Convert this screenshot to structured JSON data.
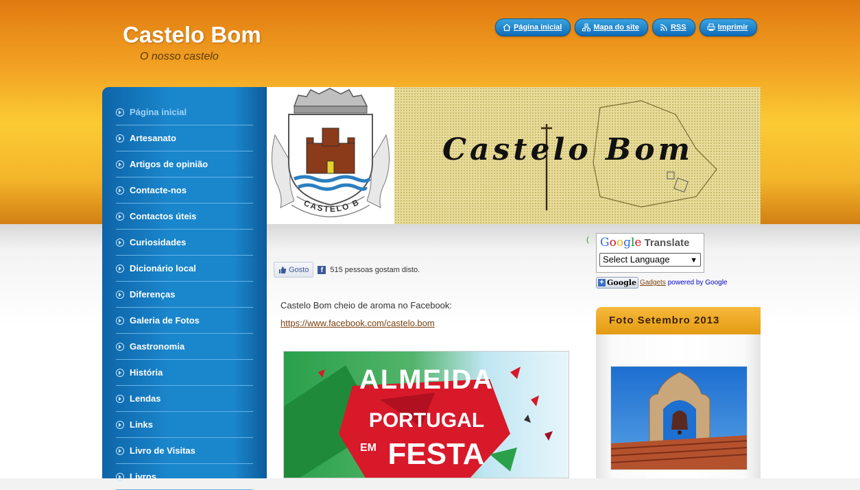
{
  "site": {
    "title": "Castelo Bom",
    "subtitle": "O nosso castelo"
  },
  "top_links": [
    {
      "label": "Página inicial",
      "icon": "home-icon"
    },
    {
      "label": "Mapa do site",
      "icon": "sitemap-icon"
    },
    {
      "label": "RSS",
      "icon": "rss-icon"
    },
    {
      "label": "Imprimir",
      "icon": "print-icon"
    }
  ],
  "nav": {
    "items": [
      {
        "label": "Página inicial",
        "active": true
      },
      {
        "label": "Artesanato"
      },
      {
        "label": "Artigos de opinião"
      },
      {
        "label": "Contacte-nos"
      },
      {
        "label": "Contactos úteis"
      },
      {
        "label": "Curiosidades"
      },
      {
        "label": "Dicionário local"
      },
      {
        "label": "Diferenças"
      },
      {
        "label": "Galeria de Fotos"
      },
      {
        "label": "Gastronomia"
      },
      {
        "label": "História"
      },
      {
        "label": "Lendas"
      },
      {
        "label": "Links"
      },
      {
        "label": "Livro de Visitas"
      },
      {
        "label": "Livros"
      }
    ]
  },
  "banner": {
    "crest_label": "CASTELO BOM",
    "title": "Castelo Bom"
  },
  "facebook": {
    "like_label": "Gosto",
    "icon": "facebook-icon",
    "count_text": "515 pessoas gostam disto."
  },
  "post": {
    "text": "Castelo Bom cheio de aroma no Facebook:",
    "link": "https://www.facebook.com/castelo.bom"
  },
  "poster": {
    "line1": "ALMEIDA",
    "line2": "PORTUGAL",
    "line3": "EM",
    "line4": "FESTA"
  },
  "translate": {
    "brand": "Google",
    "title": "Translate",
    "select_value": "Select Language",
    "stray": "("
  },
  "gadgets": {
    "button_word": "Google",
    "link_text": "Gadgets",
    "powered_text": "powered by Google"
  },
  "photo_box": {
    "title": "Foto Setembro 2013"
  },
  "colors": {
    "header_orange": "#f2a223",
    "sidebar_blue": "#1a86cc",
    "link_brown": "#7a4110",
    "photo_header": "#e49b13"
  }
}
